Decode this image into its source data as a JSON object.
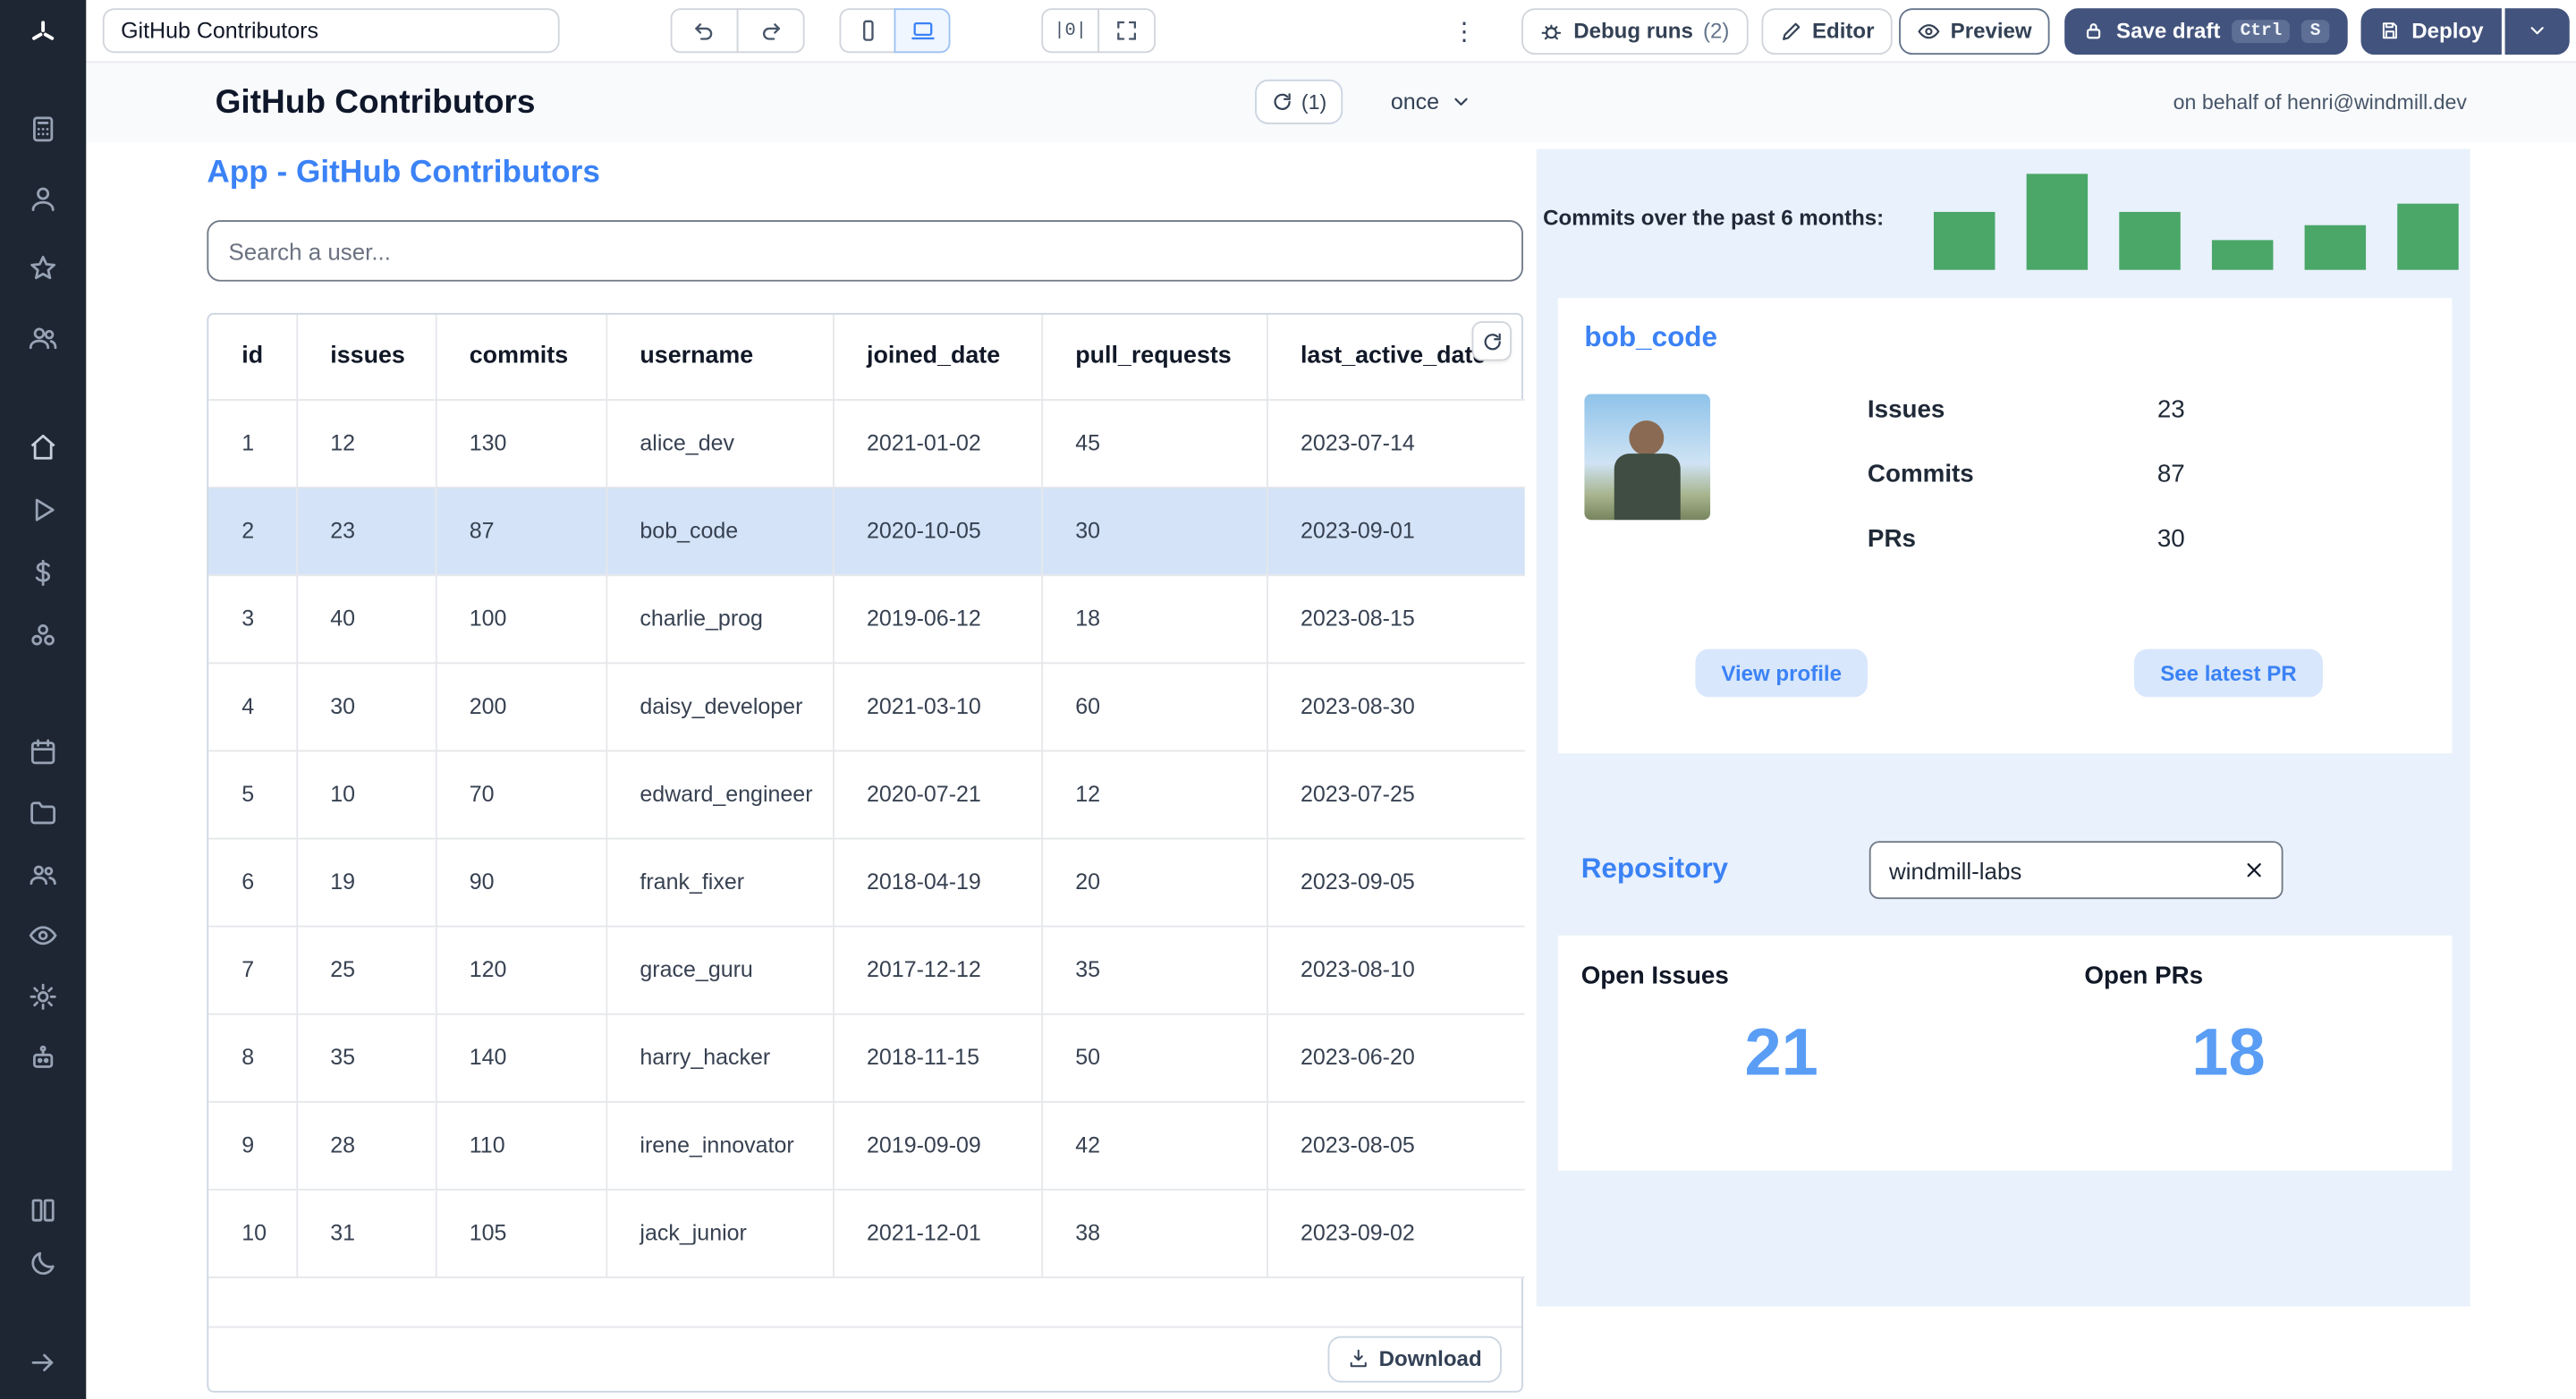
{
  "topbar": {
    "app_title_value": "GitHub Contributors",
    "debug_runs_label": "Debug runs",
    "debug_runs_count": "(2)",
    "editor_label": "Editor",
    "preview_label": "Preview",
    "save_draft_label": "Save draft",
    "kbd": [
      "Ctrl",
      "S"
    ],
    "deploy_label": "Deploy"
  },
  "header": {
    "title": "GitHub Contributors",
    "refresh_count": "(1)",
    "schedule_value": "once",
    "on_behalf": "on behalf of henri@windmill.dev"
  },
  "left": {
    "app_heading": "App - GitHub Contributors",
    "search_placeholder": "Search a user...",
    "download_label": "Download"
  },
  "table": {
    "columns": [
      "id",
      "issues",
      "commits",
      "username",
      "joined_date",
      "pull_requests",
      "last_active_date"
    ],
    "rows": [
      [
        "1",
        "12",
        "130",
        "alice_dev",
        "2021-01-02",
        "45",
        "2023-07-14"
      ],
      [
        "2",
        "23",
        "87",
        "bob_code",
        "2020-10-05",
        "30",
        "2023-09-01"
      ],
      [
        "3",
        "40",
        "100",
        "charlie_prog",
        "2019-06-12",
        "18",
        "2023-08-15"
      ],
      [
        "4",
        "30",
        "200",
        "daisy_developer",
        "2021-03-10",
        "60",
        "2023-08-30"
      ],
      [
        "5",
        "10",
        "70",
        "edward_engineer",
        "2020-07-21",
        "12",
        "2023-07-25"
      ],
      [
        "6",
        "19",
        "90",
        "frank_fixer",
        "2018-04-19",
        "20",
        "2023-09-05"
      ],
      [
        "7",
        "25",
        "120",
        "grace_guru",
        "2017-12-12",
        "35",
        "2023-08-10"
      ],
      [
        "8",
        "35",
        "140",
        "harry_hacker",
        "2018-11-15",
        "50",
        "2023-06-20"
      ],
      [
        "9",
        "28",
        "110",
        "irene_innovator",
        "2019-09-09",
        "42",
        "2023-08-05"
      ],
      [
        "10",
        "31",
        "105",
        "jack_junior",
        "2021-12-01",
        "38",
        "2023-09-02"
      ]
    ],
    "selected_row_index": 1
  },
  "panel": {
    "chart_label": "Commits over the past 6 months:",
    "chart_data": {
      "type": "bar",
      "values": [
        35,
        58,
        35,
        18,
        27,
        40
      ],
      "unit": "relative-height",
      "title": "Commits over the past 6 months",
      "bar_color": "#4aa768"
    },
    "user_card": {
      "username": "bob_code",
      "stats": [
        {
          "label": "Issues",
          "value": "23"
        },
        {
          "label": "Commits",
          "value": "87"
        },
        {
          "label": "PRs",
          "value": "30"
        }
      ],
      "view_profile_label": "View profile",
      "see_latest_pr_label": "See latest PR"
    },
    "repository": {
      "heading": "Repository",
      "input_value": "windmill-labs",
      "open_issues_label": "Open Issues",
      "open_prs_label": "Open PRs",
      "open_issues_value": "21",
      "open_prs_value": "18"
    }
  },
  "icons": {
    "sidebar": [
      "windmill-logo",
      "calculator-icon",
      "user-icon",
      "star-icon",
      "users-icon",
      "home-icon",
      "play-icon",
      "dollar-icon",
      "resources-icon",
      "calendar-icon",
      "folder-icon",
      "groups-icon",
      "eye-icon",
      "gear-icon",
      "robot-icon",
      "docs-icon",
      "moon-icon",
      "expand-sidebar-icon"
    ],
    "topbar": [
      "undo-icon",
      "redo-icon",
      "mobile-icon",
      "desktop-icon",
      "align-icon",
      "fullscreen-icon",
      "kebab-icon",
      "bug-icon",
      "pencil-icon",
      "eye-icon",
      "lock-icon",
      "save-icon",
      "chevron-down-icon"
    ],
    "other": [
      "refresh-icon",
      "download-icon",
      "close-icon"
    ]
  },
  "colors": {
    "accent_blue": "#3b82f6",
    "panel_bg": "#e9f1fc",
    "selected_row": "#d4e3f7",
    "big_number": "#5a9df5",
    "bar_green": "#4aa768",
    "dark_button": "#42537d",
    "sidebar_bg": "#1f2633"
  }
}
